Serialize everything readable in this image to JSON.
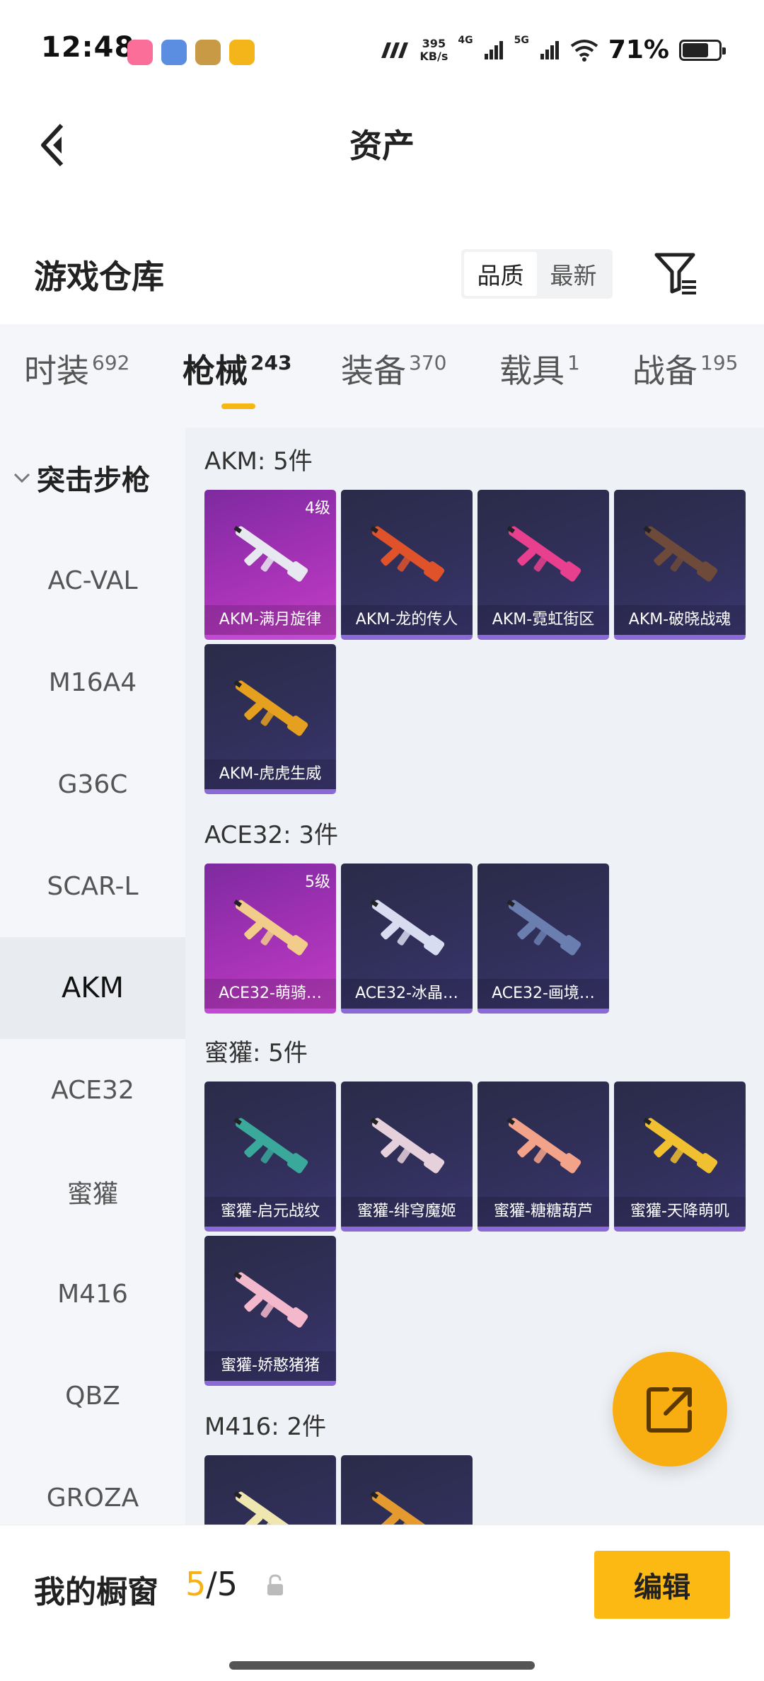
{
  "status_bar": {
    "time": "12:48",
    "net_speed_value": "395",
    "net_speed_unit": "KB/s",
    "signal1": "4G",
    "signal2": "5G",
    "battery_pct": "71%",
    "battery_level": 0.71
  },
  "header": {
    "title": "资产"
  },
  "warehouse": {
    "title": "游戏仓库",
    "sort_options": [
      "品质",
      "最新"
    ],
    "sort_selected": "品质"
  },
  "tabs": [
    {
      "label": "时装",
      "count": "692"
    },
    {
      "label": "枪械",
      "count": "243"
    },
    {
      "label": "装备",
      "count": "370"
    },
    {
      "label": "载具",
      "count": "1"
    },
    {
      "label": "战备",
      "count": "195"
    }
  ],
  "active_tab": "枪械",
  "side_nav": {
    "category": "突击步枪",
    "items": [
      "AC-VAL",
      "M16A4",
      "G36C",
      "SCAR-L",
      "AKM",
      "ACE32",
      "蜜獾",
      "M416",
      "QBZ",
      "GROZA"
    ],
    "selected": "AKM"
  },
  "groups": [
    {
      "title": "AKM: 5件",
      "items": [
        {
          "name": "AKM-满月旋律",
          "level": "4级",
          "rarity": "legend",
          "gun_color": "#e8e8f0"
        },
        {
          "name": "AKM-龙的传人",
          "level": "",
          "rarity": "epic",
          "gun_color": "#e0522a"
        },
        {
          "name": "AKM-霓虹街区",
          "level": "",
          "rarity": "epic",
          "gun_color": "#e83f8e"
        },
        {
          "name": "AKM-破晓战魂",
          "level": "",
          "rarity": "epic",
          "gun_color": "#6e4a3a"
        },
        {
          "name": "AKM-虎虎生威",
          "level": "",
          "rarity": "epic",
          "gun_color": "#e6a020"
        }
      ]
    },
    {
      "title": "ACE32: 3件",
      "items": [
        {
          "name": "ACE32-萌骑…",
          "level": "5级",
          "rarity": "legend",
          "gun_color": "#f2cc8a"
        },
        {
          "name": "ACE32-冰晶…",
          "level": "",
          "rarity": "epic",
          "gun_color": "#d8dcf0"
        },
        {
          "name": "ACE32-画境…",
          "level": "",
          "rarity": "epic",
          "gun_color": "#6a7fb0"
        }
      ]
    },
    {
      "title": "蜜獾: 5件",
      "items": [
        {
          "name": "蜜獾-启元战纹",
          "level": "",
          "rarity": "epic",
          "gun_color": "#3aa89a"
        },
        {
          "name": "蜜獾-绯穹魔姬",
          "level": "",
          "rarity": "epic",
          "gun_color": "#e6d0dc"
        },
        {
          "name": "蜜獾-糖糖葫芦",
          "level": "",
          "rarity": "epic",
          "gun_color": "#f3a38a"
        },
        {
          "name": "蜜獾-天降萌叽",
          "level": "",
          "rarity": "epic",
          "gun_color": "#f0c030"
        },
        {
          "name": "蜜獾-娇憨猪猪",
          "level": "",
          "rarity": "epic",
          "gun_color": "#f4b8cc"
        }
      ]
    },
    {
      "title": "M416: 2件",
      "items": [
        {
          "name": "",
          "level": "",
          "rarity": "epic",
          "gun_color": "#f0e6b0"
        },
        {
          "name": "",
          "level": "",
          "rarity": "epic",
          "gun_color": "#e59a30"
        }
      ]
    }
  ],
  "showcase": {
    "title": "我的橱窗",
    "current": "5",
    "separator": "/",
    "total": "5",
    "edit_label": "编辑"
  },
  "colors": {
    "accent": "#f7b712",
    "legend_card": "#a532b6",
    "epic_card": "#32305c",
    "card_underline": "#8b6ad8"
  }
}
